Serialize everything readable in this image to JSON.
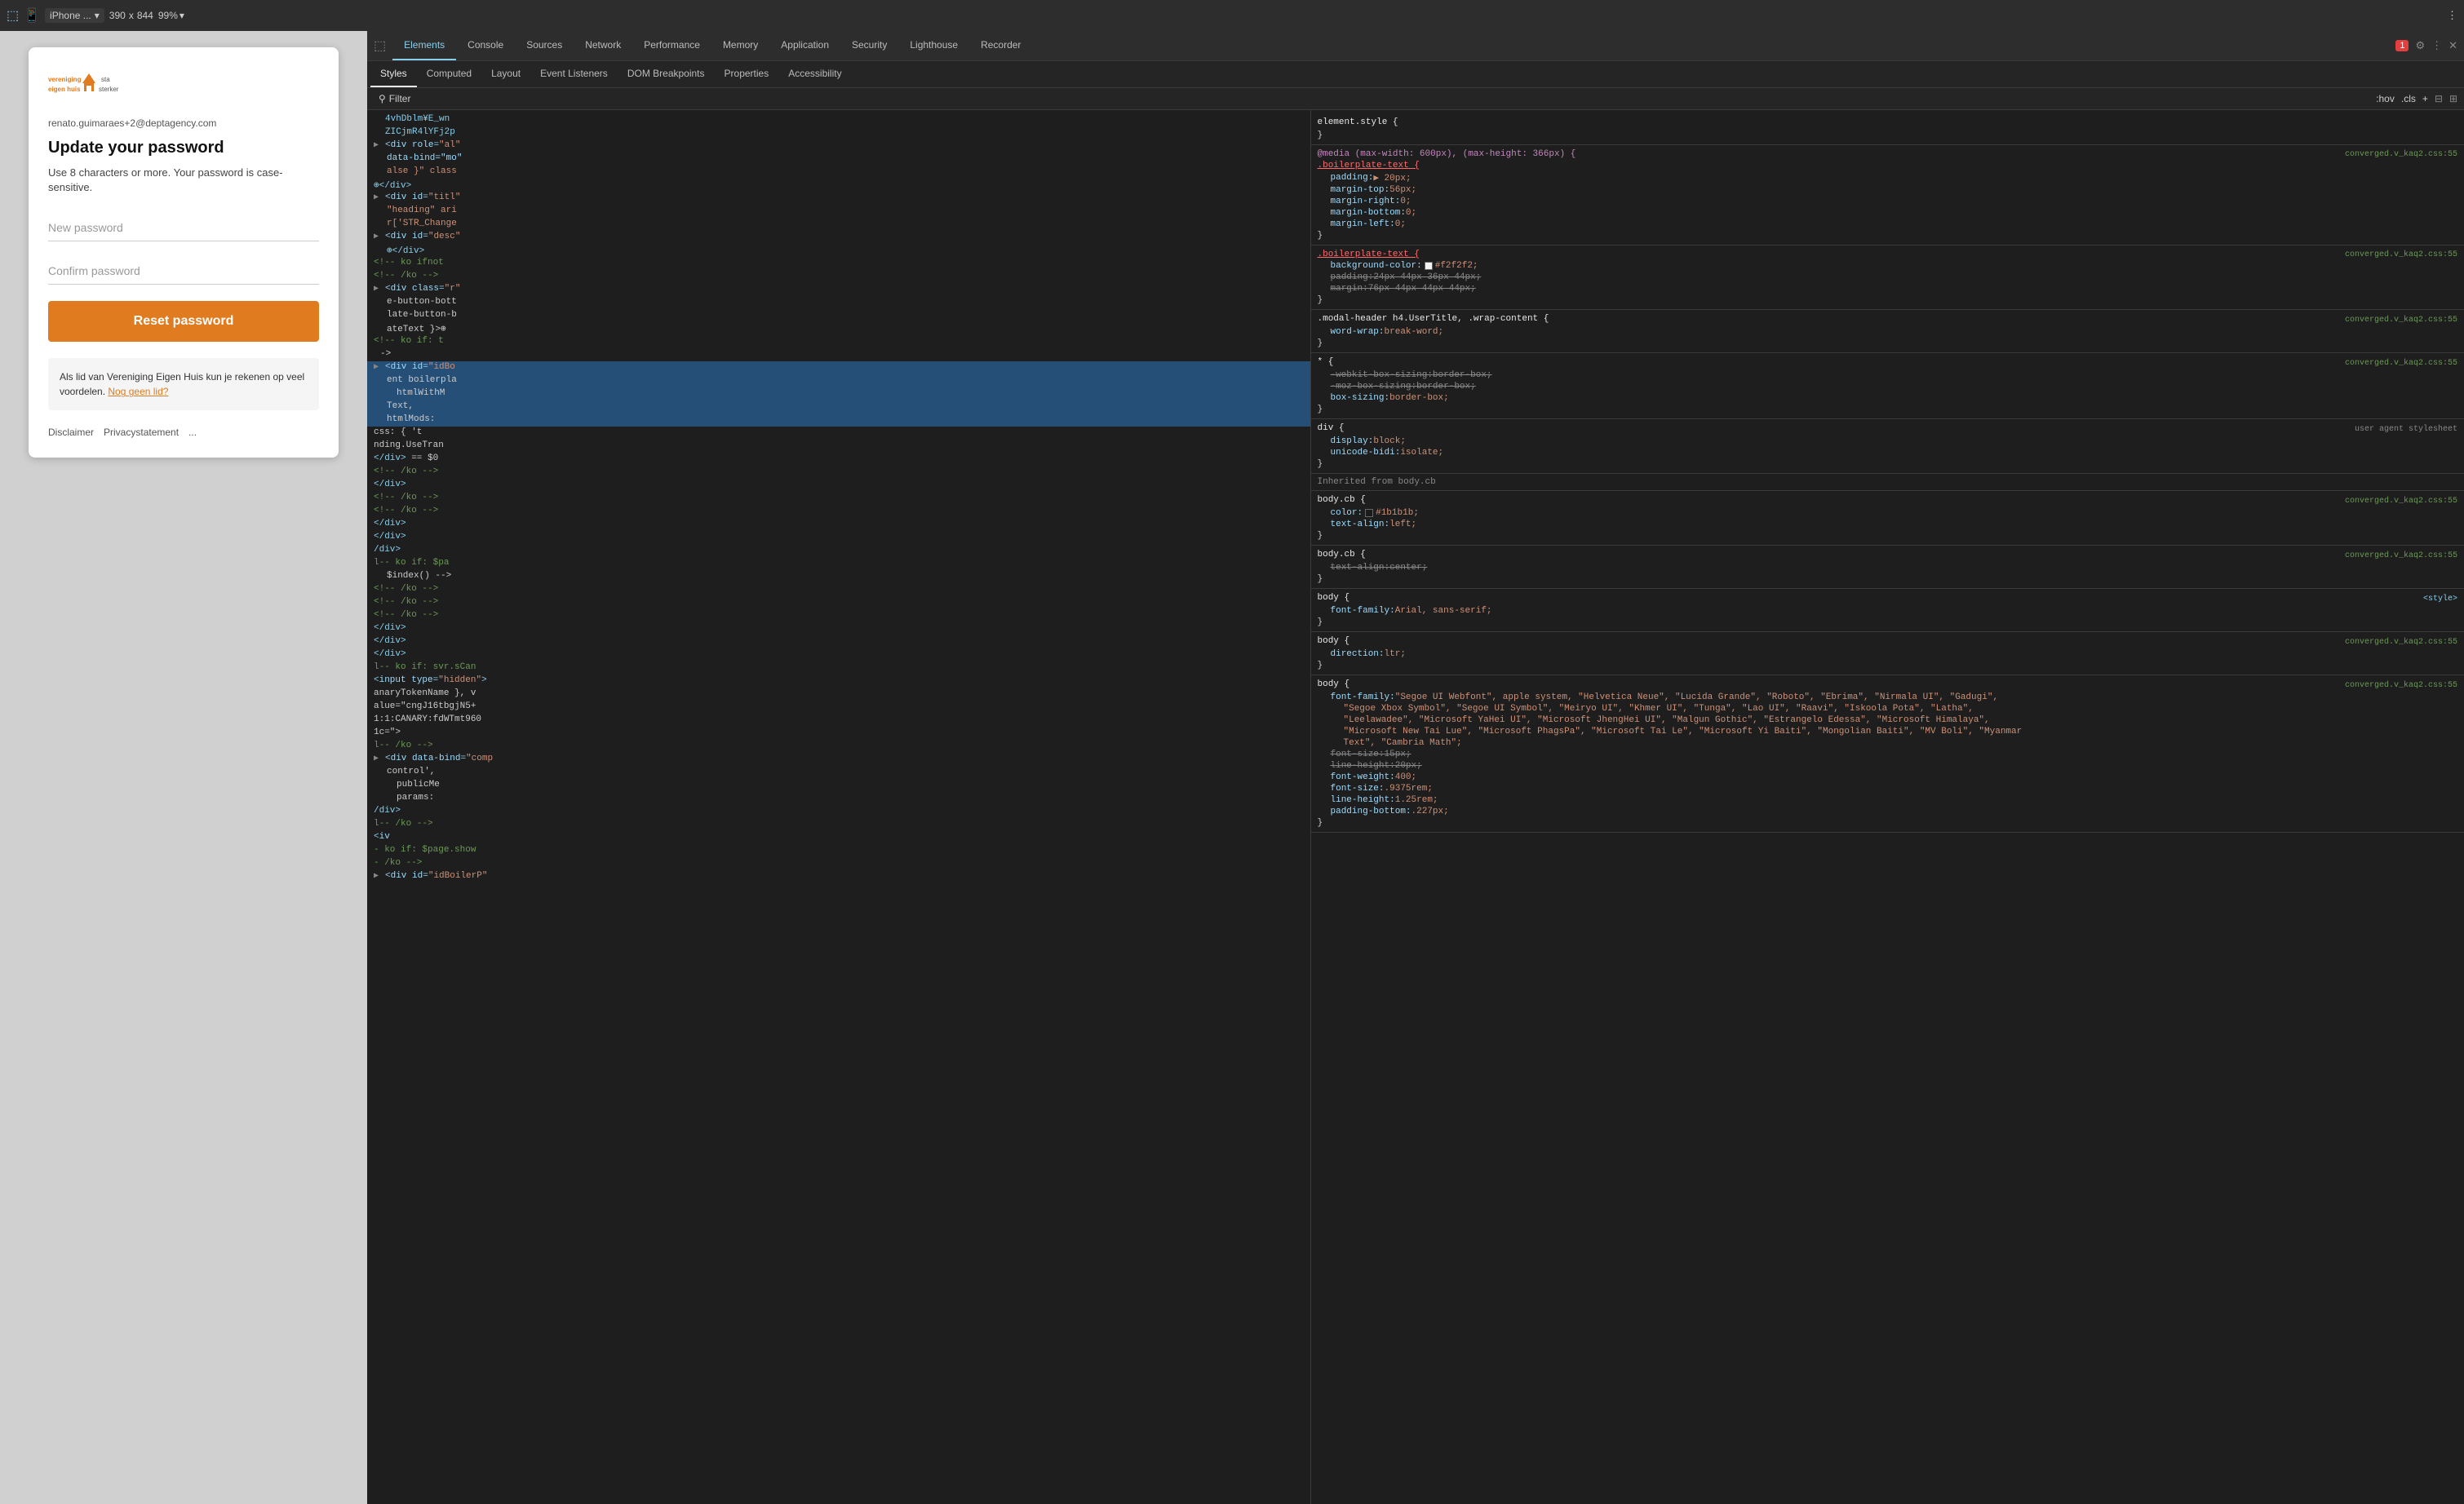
{
  "topbar": {
    "device": "iPhone ...",
    "width": "390",
    "x": "x",
    "height": "844",
    "zoom": "99%",
    "more_icon": "⋮"
  },
  "devtools": {
    "tabs": [
      {
        "label": "Elements",
        "active": true
      },
      {
        "label": "Console",
        "active": false
      },
      {
        "label": "Sources",
        "active": false
      },
      {
        "label": "Network",
        "active": false
      },
      {
        "label": "Performance",
        "active": false
      },
      {
        "label": "Memory",
        "active": false
      },
      {
        "label": "Application",
        "active": false
      },
      {
        "label": "Security",
        "active": false
      },
      {
        "label": "Lighthouse",
        "active": false
      },
      {
        "label": "Recorder",
        "active": false
      }
    ],
    "subtabs": [
      {
        "label": "Styles",
        "active": true
      },
      {
        "label": "Computed",
        "active": false
      },
      {
        "label": "Layout",
        "active": false
      },
      {
        "label": "Event Listeners",
        "active": false
      },
      {
        "label": "DOM Breakpoints",
        "active": false
      },
      {
        "label": "Properties",
        "active": false
      },
      {
        "label": "Accessibility",
        "active": false
      }
    ],
    "filter_label": "Filter",
    "filter_right": ":hov .cls + ⊕"
  },
  "preview": {
    "email": "renato.guimaraes+2@deptagency.com",
    "title": "Update your password",
    "subtitle": "Use 8 characters or more. Your password is case-sensitive.",
    "new_password_placeholder": "New password",
    "confirm_password_placeholder": "Confirm password",
    "reset_button": "Reset password",
    "info_text": "Als lid van Vereniging Eigen Huis kun je rekenen op veel voordelen.",
    "info_link": "Nog geen lid?",
    "footer": {
      "disclaimer": "Disclaimer",
      "privacy": "Privacystatement",
      "more": "..."
    }
  },
  "html_lines": [
    {
      "indent": 0,
      "content": "4vhDblm¥E_wn",
      "type": "text",
      "expand": false
    },
    {
      "indent": 0,
      "content": "ZICjmR4lYFj2p",
      "type": "text",
      "expand": false
    },
    {
      "indent": 0,
      "tag": "div",
      "attrs": "role=\"al\"",
      "expand": true
    },
    {
      "indent": 1,
      "content": "data-bind=\"mo\"",
      "type": "attr"
    },
    {
      "indent": 1,
      "content": "alse }\" class",
      "type": "attr"
    },
    {
      "indent": 0,
      "content": "⊕</div>",
      "type": "close"
    },
    {
      "indent": 0,
      "tag": "div",
      "id": "titl",
      "expand": true
    },
    {
      "indent": 1,
      "content": "\"heading\" ari",
      "type": "attr"
    },
    {
      "indent": 1,
      "content": "r['STR_Change",
      "type": "attr"
    },
    {
      "indent": 0,
      "tag": "div",
      "id": "desc",
      "expand": true
    },
    {
      "indent": 1,
      "content": "⊕</div>",
      "type": "close"
    },
    {
      "indent": 0,
      "content": "<!-- ko ifnot",
      "type": "comment"
    },
    {
      "indent": 0,
      "content": "<!-- /ko -->",
      "type": "comment"
    },
    {
      "indent": 0,
      "tag": "div",
      "class": "\"",
      "expand": true
    },
    {
      "indent": 0,
      "tag": "div",
      "class": "r",
      "expand": true
    },
    {
      "indent": 1,
      "content": "e-button-bott",
      "type": "text"
    },
    {
      "indent": 1,
      "content": "late-button-b",
      "type": "text"
    },
    {
      "indent": 1,
      "content": "ateText }\">⊕",
      "type": "text"
    },
    {
      "indent": 0,
      "content": "<!-- ko if: t",
      "type": "comment"
    },
    {
      "indent": 1,
      "content": "->",
      "type": "text"
    },
    {
      "indent": 0,
      "tag": "div",
      "id": "idBo",
      "expand": true,
      "selected": true
    },
    {
      "indent": 1,
      "content": "ent boilerpla",
      "type": "text"
    },
    {
      "indent": 2,
      "content": "htmlWithM",
      "type": "text"
    },
    {
      "indent": 1,
      "content": "Text,",
      "type": "text"
    },
    {
      "indent": 1,
      "content": "htmlMods:",
      "type": "text"
    },
    {
      "indent": 0,
      "content": "css: { 't",
      "type": "text"
    },
    {
      "indent": 0,
      "content": "nding.UseTran",
      "type": "text"
    },
    {
      "indent": 0,
      "content": "</div> == $0",
      "type": "close"
    },
    {
      "indent": 0,
      "content": "<!-- /ko -->",
      "type": "comment"
    },
    {
      "indent": 0,
      "content": "</div>",
      "type": "close"
    },
    {
      "indent": 0,
      "content": "<!-- /ko -->",
      "type": "comment"
    },
    {
      "indent": 0,
      "content": "<!-- /ko -->",
      "type": "comment"
    },
    {
      "indent": 0,
      "content": "</div>",
      "type": "close"
    },
    {
      "indent": 0,
      "content": "</div>",
      "type": "close"
    },
    {
      "indent": 0,
      "content": "/div>",
      "type": "close"
    },
    {
      "indent": 0,
      "content": "l-- ko if: $pa",
      "type": "comment"
    },
    {
      "indent": 1,
      "content": "$index() -->",
      "type": "text"
    },
    {
      "indent": 0,
      "content": "<!-- /ko -->",
      "type": "comment"
    },
    {
      "indent": 0,
      "content": "<!-- /ko -->",
      "type": "comment"
    },
    {
      "indent": 0,
      "content": "<!-- /ko -->",
      "type": "comment"
    },
    {
      "indent": 0,
      "content": "</div>",
      "type": "close"
    },
    {
      "indent": 0,
      "content": "</div>",
      "type": "close"
    },
    {
      "indent": 0,
      "content": "</div>",
      "type": "close"
    },
    {
      "indent": 0,
      "content": "l-- ko if: svr.sCan",
      "type": "comment"
    },
    {
      "indent": 0,
      "tag": "input",
      "attrs": "type=\"hidden\"",
      "expand": false
    },
    {
      "indent": 0,
      "content": "anaryTokenName }, v",
      "type": "text"
    },
    {
      "indent": 0,
      "content": "alue=\"cngJ16tbgjN5+",
      "type": "text"
    },
    {
      "indent": 0,
      "content": "1:1:CANARY:fdWTmt960",
      "type": "text"
    },
    {
      "indent": 0,
      "content": "1c=\">",
      "type": "text"
    },
    {
      "indent": 0,
      "content": "l-- /ko -->",
      "type": "comment"
    },
    {
      "indent": 0,
      "tag": "div",
      "attrs": "data-bind=\"comp",
      "expand": true
    },
    {
      "indent": 1,
      "content": "control',",
      "type": "text"
    },
    {
      "indent": 2,
      "content": "publicMe",
      "type": "text"
    },
    {
      "indent": 2,
      "content": "params:",
      "type": "text"
    },
    {
      "indent": 0,
      "content": "/div>",
      "type": "close"
    },
    {
      "indent": 0,
      "content": "l-- /ko -->",
      "type": "comment"
    },
    {
      "indent": 0,
      "tag": "iv"
    },
    {
      "indent": 0,
      "content": "- ko if: $page.show",
      "type": "comment"
    },
    {
      "indent": 0,
      "content": "- /ko -->",
      "type": "comment"
    },
    {
      "indent": 0,
      "tag": "div",
      "id": "idBoilerP"
    }
  ],
  "styles": [
    {
      "type": "element",
      "selector": "element.style {",
      "props": [],
      "source": ""
    },
    {
      "type": "media",
      "query": "@media (max-width: 600px), (max-height: 366px) {",
      "selector": ".boilerplate-text {",
      "selector_color": "#ff6b6b",
      "source": "converged.v_kaq2.css:55",
      "props": [
        {
          "name": "padding:",
          "value": "▶ 20px;",
          "strikethrough": false
        },
        {
          "name": "margin-top:",
          "value": "56px;",
          "strikethrough": false
        },
        {
          "name": "margin-right:",
          "value": "0;",
          "strikethrough": false
        },
        {
          "name": "margin-bottom:",
          "value": "0;",
          "strikethrough": false
        },
        {
          "name": "margin-left:",
          "value": "0;",
          "strikethrough": false
        }
      ]
    },
    {
      "type": "rule",
      "selector": ".boilerplate-text {",
      "selector_color": "#ff6b6b",
      "source": "converged.v_kaq2.css:55",
      "props": [
        {
          "name": "background-color:",
          "value": "#f2f2f2;",
          "swatch": "#f2f2f2",
          "strikethrough": false
        },
        {
          "name": "padding:",
          "value": "24px 44px 36px 44px;",
          "strikethrough": true
        },
        {
          "name": "margin:",
          "value": "76px  44px  44px  44px;",
          "strikethrough": true
        }
      ]
    },
    {
      "type": "rule",
      "selector": ".modal-header h4.UserTitle, .wrap-content {",
      "source": "converged.v_kaq2.css:55",
      "props": [
        {
          "name": "word-wrap:",
          "value": "break-word;",
          "strikethrough": false
        }
      ]
    },
    {
      "type": "rule",
      "selector": "* {",
      "source": "converged.v_kaq2.css:55",
      "props": [
        {
          "name": "-webkit-box-sizing:",
          "value": "border-box;",
          "strikethrough": true
        },
        {
          "name": "-moz-box-sizing:",
          "value": "border-box;",
          "strikethrough": true
        },
        {
          "name": "box-sizing:",
          "value": "border-box;",
          "strikethrough": false
        }
      ]
    },
    {
      "type": "rule",
      "selector": "div {",
      "source": "user agent stylesheet",
      "props": [
        {
          "name": "display:",
          "value": "block;",
          "strikethrough": false
        },
        {
          "name": "unicode-bidi:",
          "value": "isolate;",
          "strikethrough": false
        }
      ]
    },
    {
      "type": "inherited",
      "label": "Inherited from body.cb"
    },
    {
      "type": "rule",
      "selector": "body.cb {",
      "source": "converged.v_kaq2.css:55",
      "props": [
        {
          "name": "color:",
          "value": "#1b1b1b;",
          "swatch": "#1b1b1b",
          "strikethrough": false
        },
        {
          "name": "text-align:",
          "value": "left;",
          "strikethrough": false
        }
      ]
    },
    {
      "type": "rule",
      "selector": "body.cb {",
      "source": "converged.v_kaq2.css:55",
      "props": [
        {
          "name": "text-align:",
          "value": "center;",
          "strikethrough": true
        }
      ]
    },
    {
      "type": "rule",
      "selector": "body {",
      "source": "<style>",
      "props": [
        {
          "name": "font-family:",
          "value": "Arial, sans-serif;",
          "strikethrough": false
        }
      ]
    },
    {
      "type": "rule",
      "selector": "body {",
      "source": "converged.v_kaq2.css:55",
      "props": [
        {
          "name": "direction:",
          "value": "ltr;",
          "strikethrough": false
        }
      ]
    },
    {
      "type": "rule",
      "selector": "body {",
      "source": "converged.v_kaq2.css:55",
      "props": [
        {
          "name": "font-family:",
          "value": "\"Segoe UI Webfont\", apple system, \"Helvetica Neue\", \"Lucida Grande\", \"Roboto\", \"Ebrima\", \"Nirmala UI\", \"Gadugi\",",
          "strikethrough": false
        },
        {
          "name": "",
          "value": "\"Segoe Xbox Symbol\", \"Segoe UI Symbol\", \"Meiryo UI\", \"Khmer UI\", \"Tunga\", \"Lao UI\", \"Raavi\", \"Iskoola Pota\", \"Latha\",",
          "strikethrough": false
        },
        {
          "name": "",
          "value": "\"Leelawadee\", \"Microsoft YaHei UI\", \"Microsoft JhengHei UI\", \"Malgun Gothic\", \"Estrangelo Edessa\", \"Microsoft Himalaya\",",
          "strikethrough": false
        },
        {
          "name": "",
          "value": "\"Microsoft New Tai Lue\", \"Microsoft PhagsPa\", \"Microsoft Tai Le\", \"Microsoft Yi Baiti\", \"Mongolian Baiti\", \"MV Boli\", \"Myanmar",
          "strikethrough": false
        },
        {
          "name": "",
          "value": "Text\", \"Cambria Math\";",
          "strikethrough": false
        },
        {
          "name": "font-size:",
          "value": "15px;",
          "strikethrough": true
        },
        {
          "name": "line-height:",
          "value": "20px;",
          "strikethrough": true
        },
        {
          "name": "font-weight:",
          "value": "400;",
          "strikethrough": false
        },
        {
          "name": "font-size:",
          "value": ".9375rem;",
          "strikethrough": false
        },
        {
          "name": "line-height:",
          "value": "1.25rem;",
          "strikethrough": false
        },
        {
          "name": "padding-bottom:",
          "value": ".227px;",
          "strikethrough": false
        }
      ]
    }
  ],
  "badge": {
    "count": "1",
    "color": "#e53e3e"
  }
}
